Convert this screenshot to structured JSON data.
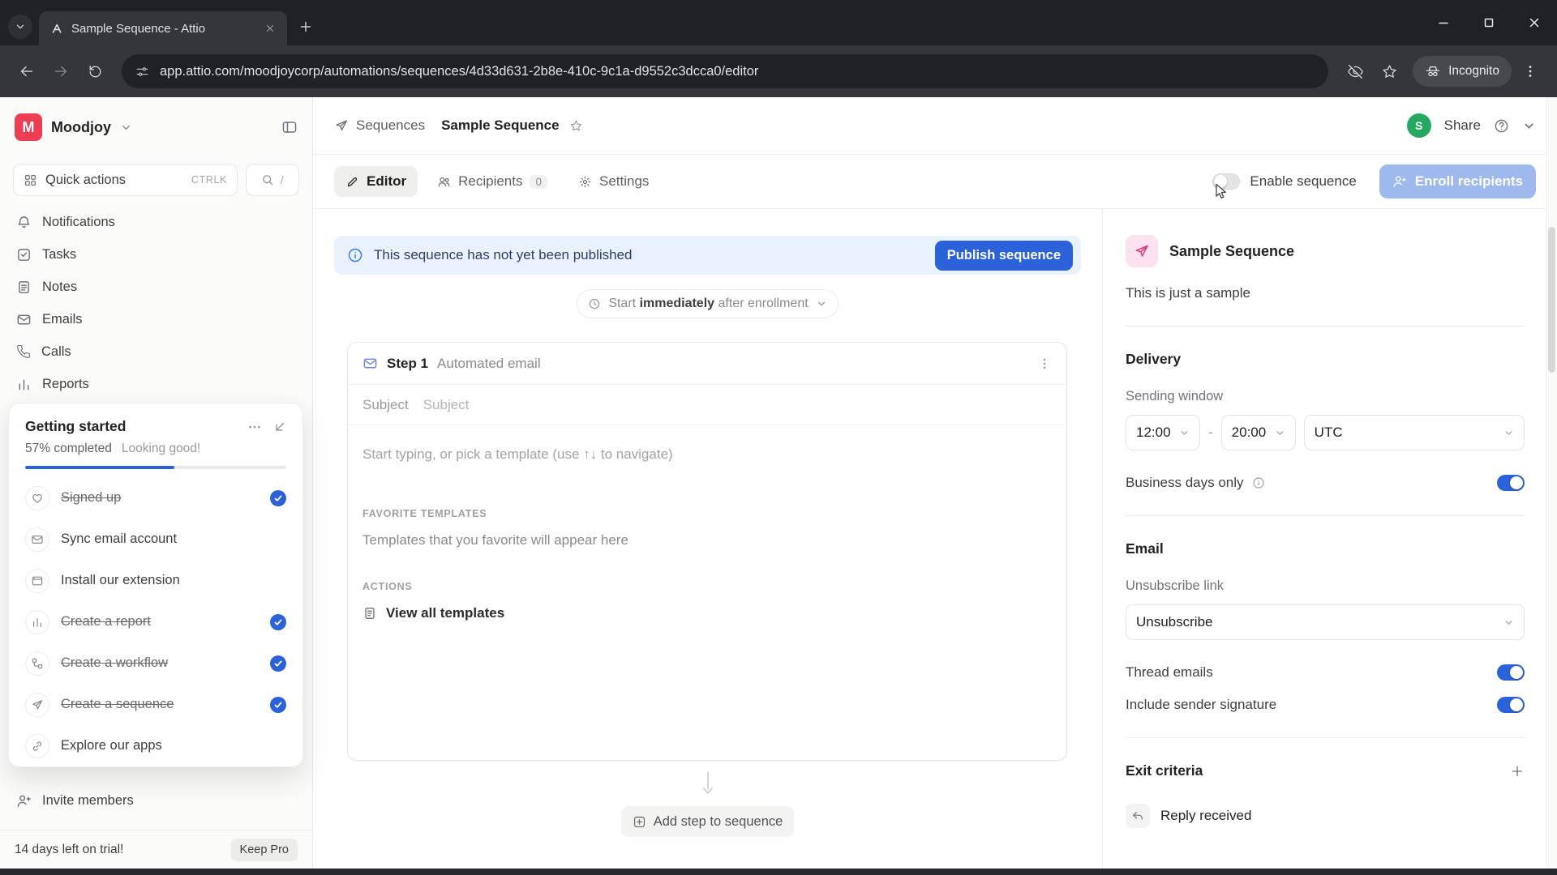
{
  "browser": {
    "tab_title": "Sample Sequence - Attio",
    "url": "app.attio.com/moodjoycorp/automations/sequences/4d33d631-2b8e-410c-9c1a-d9552c3dcca0/editor",
    "incognito_label": "Incognito"
  },
  "workspace": {
    "logo_letter": "M",
    "name": "Moodjoy"
  },
  "sidebar": {
    "quick_actions": {
      "label": "Quick actions",
      "shortcut": "CTRLK",
      "search_shortcut": "/"
    },
    "items": [
      {
        "label": "Notifications",
        "icon": "bell-icon"
      },
      {
        "label": "Tasks",
        "icon": "task-icon"
      },
      {
        "label": "Notes",
        "icon": "note-icon"
      },
      {
        "label": "Emails",
        "icon": "envelope-icon"
      },
      {
        "label": "Calls",
        "icon": "phone-icon"
      },
      {
        "label": "Reports",
        "icon": "chart-icon"
      }
    ],
    "invite_members": "Invite members",
    "trial_text": "14 days left on trial!",
    "keep_pro": "Keep Pro"
  },
  "getting_started": {
    "title": "Getting started",
    "progress_text": "57% completed",
    "progress_note": "Looking good!",
    "progress_percent": 57,
    "items": [
      {
        "label": "Signed up",
        "done": true,
        "icon": "heart-icon"
      },
      {
        "label": "Sync email account",
        "done": false,
        "icon": "envelope-icon"
      },
      {
        "label": "Install our extension",
        "done": false,
        "icon": "extension-icon"
      },
      {
        "label": "Create a report",
        "done": true,
        "icon": "chart-icon"
      },
      {
        "label": "Create a workflow",
        "done": true,
        "icon": "workflow-icon"
      },
      {
        "label": "Create a sequence",
        "done": true,
        "icon": "sequence-icon"
      },
      {
        "label": "Explore our apps",
        "done": false,
        "icon": "link-icon"
      }
    ]
  },
  "header": {
    "breadcrumb": "Sequences",
    "title": "Sample Sequence",
    "avatar_letter": "S",
    "share": "Share"
  },
  "tabs": {
    "editor": "Editor",
    "recipients": "Recipients",
    "recipients_count": "0",
    "settings": "Settings",
    "enable_sequence": "Enable sequence",
    "enroll_recipients": "Enroll recipients"
  },
  "editor": {
    "banner_text": "This sequence has not yet been published",
    "publish_button": "Publish sequence",
    "start_prefix": "Start",
    "start_emphasis": "immediately",
    "start_suffix": "after enrollment",
    "step_label": "Step 1",
    "step_type": "Automated email",
    "subject_label": "Subject",
    "subject_placeholder": "Subject",
    "body_placeholder": "Start typing, or pick a template (use ↑↓ to navigate)",
    "favorites_heading": "FAVORITE TEMPLATES",
    "favorites_empty": "Templates that you favorite will appear here",
    "actions_heading": "ACTIONS",
    "view_all_templates": "View all templates",
    "add_step": "Add step to sequence"
  },
  "details": {
    "title": "Sample Sequence",
    "description": "This is just a sample",
    "delivery_heading": "Delivery",
    "sending_window_label": "Sending window",
    "window_start": "12:00",
    "window_separator": "-",
    "window_end": "20:00",
    "timezone": "UTC",
    "business_days_label": "Business days only",
    "email_heading": "Email",
    "unsubscribe_label": "Unsubscribe link",
    "unsubscribe_value": "Unsubscribe",
    "thread_emails_label": "Thread emails",
    "signature_label": "Include sender signature",
    "exit_criteria_heading": "Exit criteria",
    "exit_item": "Reply received"
  },
  "colors": {
    "accent_blue": "#2b62d9",
    "brand_red": "#ee3e54",
    "sequence_pink": "#d93a80",
    "avatar_green": "#26a862",
    "banner_bg": "#e9f1fd",
    "chrome_dark": "#202124",
    "chrome_mid": "#35363a"
  },
  "icons": {
    "legend": "semantic icon names are carried on data-name attributes with -icon suffix"
  }
}
